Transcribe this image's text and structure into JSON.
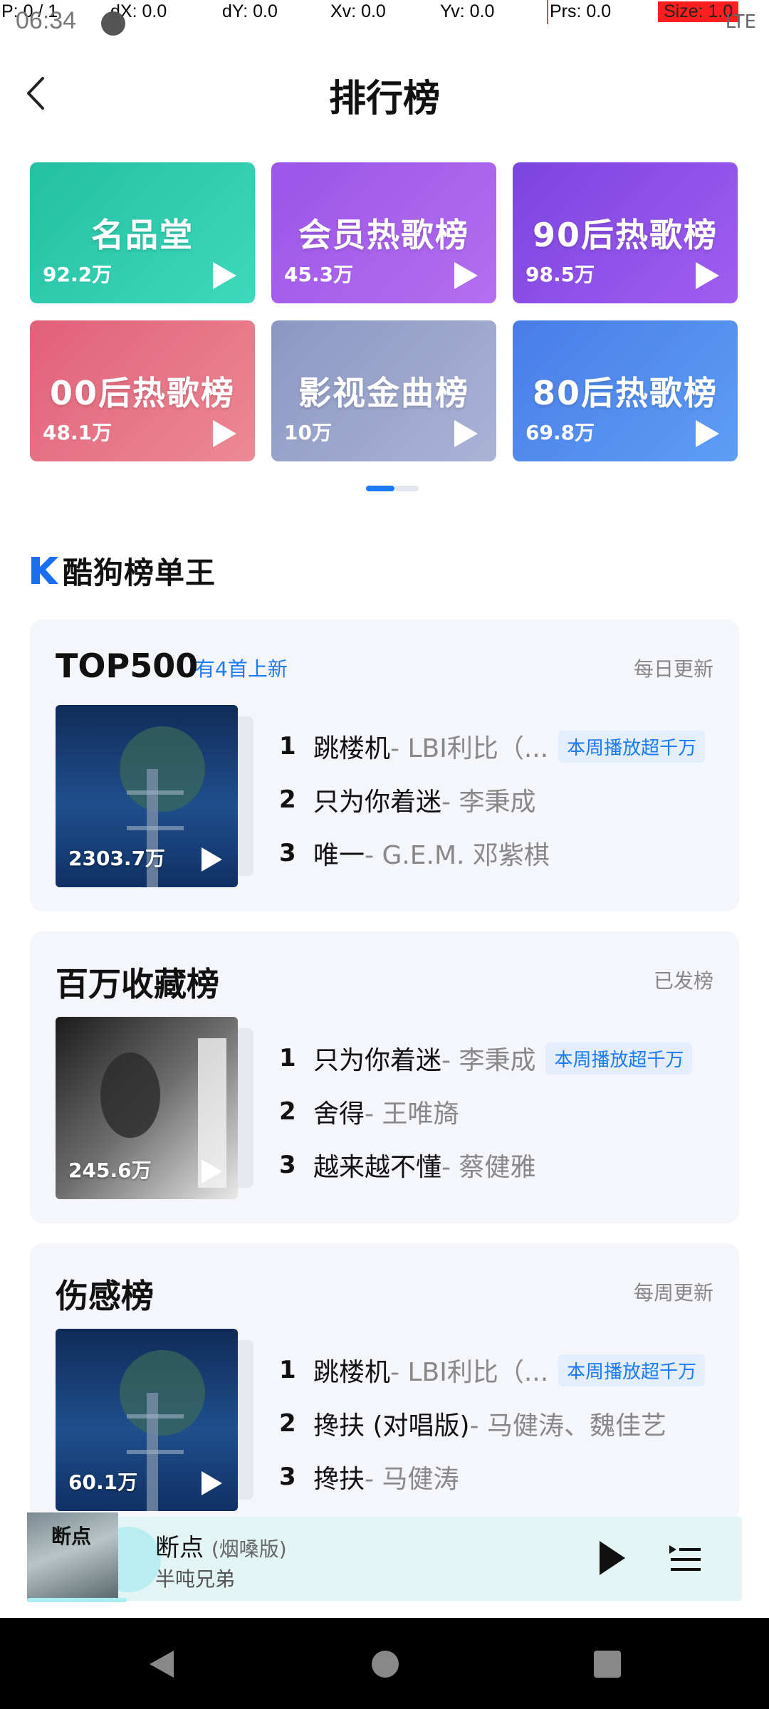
{
  "debug": {
    "pointer": "P: 0 / 1",
    "dx": "dX: 0.0",
    "dy": "dY: 0.0",
    "xv": "Xv: 0.0",
    "yv": "Yv: 0.0",
    "prs": "Prs: 0.0",
    "size": "Size: 1.0"
  },
  "status": {
    "time": "06:34",
    "right": "LTE"
  },
  "header": {
    "title": "排行榜"
  },
  "tiles": [
    {
      "name": "名品堂",
      "count": "92.2万"
    },
    {
      "name": "会员热歌榜",
      "count": "45.3万"
    },
    {
      "name": "90后热歌榜",
      "count": "98.5万"
    },
    {
      "name": "00后热歌榜",
      "count": "48.1万"
    },
    {
      "name": "影视金曲榜",
      "count": "10万"
    },
    {
      "name": "80后热歌榜",
      "count": "69.8万"
    }
  ],
  "brand": {
    "text": "酷狗榜单王"
  },
  "charts": [
    {
      "title": "TOP500",
      "new_text": "有4首上新",
      "update": "每日更新",
      "cover_count": "2303.7万",
      "songs": [
        {
          "rank": "1",
          "song": "跳楼机",
          "artist": " - LBI利比（...",
          "tag": "本周播放超千万"
        },
        {
          "rank": "2",
          "song": "只为你着迷",
          "artist": " - 李秉成",
          "tag": ""
        },
        {
          "rank": "3",
          "song": "唯一",
          "artist": " - G.E.M. 邓紫棋",
          "tag": ""
        }
      ]
    },
    {
      "title": "百万收藏榜",
      "new_text": "",
      "update": "已发榜",
      "cover_count": "245.6万",
      "songs": [
        {
          "rank": "1",
          "song": "只为你着迷",
          "artist": " - 李秉成",
          "tag": "本周播放超千万"
        },
        {
          "rank": "2",
          "song": "舍得",
          "artist": " - 王唯旖",
          "tag": ""
        },
        {
          "rank": "3",
          "song": "越来越不懂",
          "artist": " - 蔡健雅",
          "tag": ""
        }
      ]
    },
    {
      "title": "伤感榜",
      "new_text": "",
      "update": "每周更新",
      "cover_count": "60.1万",
      "songs": [
        {
          "rank": "1",
          "song": "跳楼机",
          "artist": " - LBI利比（...",
          "tag": "本周播放超千万"
        },
        {
          "rank": "2",
          "song": "搀扶 (对唱版)",
          "artist": " - 马健涛、魏佳艺",
          "tag": ""
        },
        {
          "rank": "3",
          "song": "搀扶",
          "artist": " - 马健涛",
          "tag": ""
        }
      ]
    }
  ],
  "player": {
    "cover_text": "断点",
    "title": "断点",
    "subtitle": "(烟嗓版)",
    "artist": "半吨兄弟"
  },
  "colors": {
    "accent": "#1a7af8",
    "tile_1": "#2cc9a8",
    "tile_2": "#a157e8",
    "tile_3": "#8b4fe6",
    "tile_4": "#e46a80",
    "tile_5": "#97a2c8",
    "tile_6": "#4f86ee"
  }
}
